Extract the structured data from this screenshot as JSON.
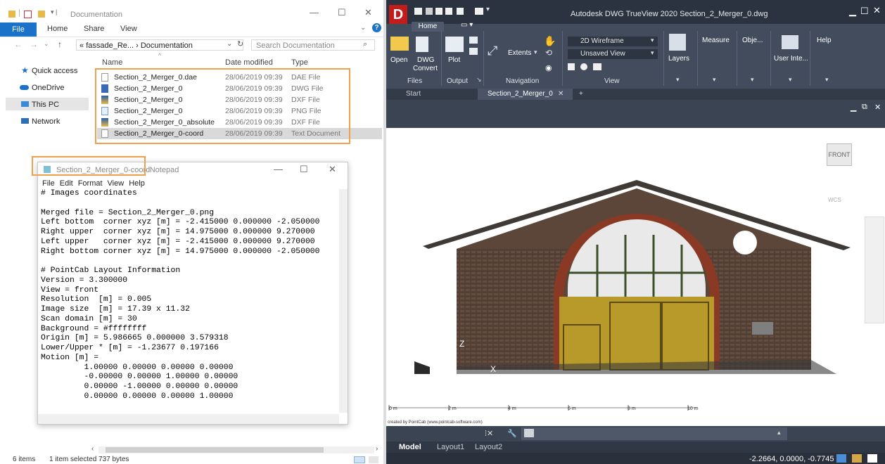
{
  "explorer": {
    "title": "Documentation",
    "ribbon_tabs": [
      "File",
      "Home",
      "Share",
      "View"
    ],
    "address": [
      "«",
      "fassade_Re...",
      "›",
      "Documentation"
    ],
    "search_placeholder": "Search Documentation",
    "nav": [
      {
        "label": "Quick access",
        "icon": "star-icon"
      },
      {
        "label": "OneDrive",
        "icon": "cloud-icon"
      },
      {
        "label": "This PC",
        "icon": "computer-icon"
      },
      {
        "label": "Network",
        "icon": "network-icon"
      }
    ],
    "columns": [
      "Name",
      "Date modified",
      "Type"
    ],
    "files": [
      {
        "name": "Section_2_Merger_0.dae",
        "date": "28/06/2019 09:39",
        "type": "DAE File",
        "icon": "dae-file-icon"
      },
      {
        "name": "Section_2_Merger_0",
        "date": "28/06/2019 09:39",
        "type": "DWG File",
        "icon": "dwg-file-icon"
      },
      {
        "name": "Section_2_Merger_0",
        "date": "28/06/2019 09:39",
        "type": "DXF File",
        "icon": "dxf-file-icon"
      },
      {
        "name": "Section_2_Merger_0",
        "date": "28/06/2019 09:39",
        "type": "PNG File",
        "icon": "png-file-icon"
      },
      {
        "name": "Section_2_Merger_0_absolute",
        "date": "28/06/2019 09:39",
        "type": "DXF File",
        "icon": "dxf-file-icon"
      },
      {
        "name": "Section_2_Merger_0-coord",
        "date": "28/06/2019 09:39",
        "type": "Text Document",
        "icon": "txt-file-icon"
      }
    ],
    "status_count": "6 items",
    "status_selected": "1 item selected  737 bytes"
  },
  "notepad": {
    "title_file": "Section_2_Merger_0-coord",
    "title_app": "- Notepad",
    "menu": [
      "File",
      "Edit",
      "Format",
      "View",
      "Help"
    ],
    "lines": [
      "# Images coordinates",
      "",
      "Merged file = Section_2_Merger_0.png",
      "Left bottom  corner xyz [m] = -2.415000 0.000000 -2.050000",
      "Right upper  corner xyz [m] = 14.975000 0.000000 9.270000",
      "Left upper   corner xyz [m] = -2.415000 0.000000 9.270000",
      "Right bottom corner xyz [m] = 14.975000 0.000000 -2.050000",
      "",
      "# PointCab Layout Information",
      "Version = 3.300000",
      "View = front",
      "Resolution  [m] = 0.005",
      "Image size  [m] = 17.39 x 11.32",
      "Scan domain [m] = 30",
      "Background = #ffffffff",
      "Origin [m] = 5.986665 0.000000 3.579318",
      "Lower/Upper * [m] = -1.23677 0.197166",
      "Motion [m] =",
      "         1.00000 0.00000 0.00000 0.00000",
      "         -0.00000 0.00000 1.00000 0.00000",
      "         0.00000 -1.00000 0.00000 0.00000",
      "         0.00000 0.00000 0.00000 1.00000"
    ]
  },
  "trueview": {
    "title": "Autodesk DWG TrueView 2020   Section_2_Merger_0.dwg",
    "logo": "D",
    "tab_home": "Home",
    "buttons": {
      "open": "Open",
      "dwg_convert_1": "DWG",
      "dwg_convert_2": "Convert",
      "plot": "Plot",
      "extents": "Extents",
      "visual_style": "2D Wireframe",
      "named_view": "Unsaved View",
      "layers": "Layers",
      "measure": "Measure",
      "object": "Obje...",
      "user_interface": "User Inte...",
      "help": "Help"
    },
    "groups": [
      "Files",
      "Output",
      "Navigation",
      "View"
    ],
    "doc_tabs": {
      "start": "Start",
      "active": "Section_2_Merger_0"
    },
    "viewcube": "FRONT",
    "wcs": "WCS",
    "scale_labels": [
      "0 m",
      "2 m",
      "4 m",
      "6 m",
      "8 m",
      "10 m"
    ],
    "credit": "created by PointCab (www.pointcab-software.com)",
    "axis_z": "Z",
    "axis_x": "X",
    "layout_tabs": [
      "Model",
      "Layout1",
      "Layout2"
    ],
    "coords": "-2.2664, 0.0000, -0.7745",
    "colors": {
      "title_bg": "#2b3340",
      "ribbon_bg": "#424c5c",
      "logo": "#c41b1b",
      "brick": "#5a4438",
      "door": "#b89a2a",
      "highlight": "#f0a04a"
    }
  }
}
